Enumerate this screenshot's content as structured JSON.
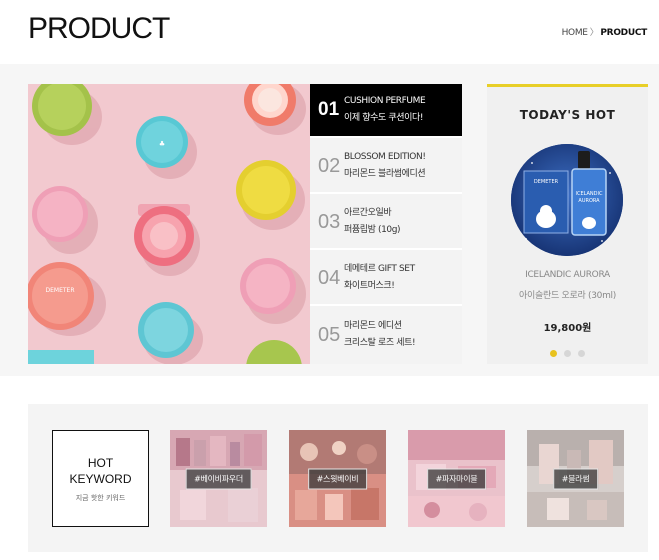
{
  "page": {
    "title": "PRODUCT"
  },
  "breadcrumb": {
    "home": "HOME",
    "separator": "〉",
    "current": "PRODUCT"
  },
  "product_list": [
    {
      "num": "01",
      "line1": "CUSHION PERFUME",
      "line2": "이제 향수도 쿠션이다!",
      "active": true
    },
    {
      "num": "02",
      "line1": "BLOSSOM EDITION!",
      "line2": "마리몬드 블라썸에디션",
      "active": false
    },
    {
      "num": "03",
      "line1": "아르간오일바",
      "line2": "퍼퓸립밤 (10g)",
      "active": false
    },
    {
      "num": "04",
      "line1": "데메테르 GIFT SET",
      "line2": "화이트머스크!",
      "active": false
    },
    {
      "num": "05",
      "line1": "마리몬드 에디션",
      "line2": "크리스탈 로즈 세트!",
      "active": false
    }
  ],
  "todays_hot": {
    "title": "TODAY'S HOT",
    "product_name": "ICELANDIC AURORA",
    "product_name_ko": "아이슬란드 오로라 (30ml)",
    "price": "19,800원",
    "slides": 3,
    "active_slide": 1
  },
  "keyword": {
    "box_line1": "HOT",
    "box_line2": "KEYWORD",
    "box_sub": "지금 핫한 키워드",
    "tags": [
      "#베이비파우더",
      "#스윗베이비",
      "#파자마이블",
      "#블라썸"
    ]
  },
  "colors": {
    "accent": "#e8cf28",
    "active_bg": "#000000",
    "hero_bg": "#f2c9cf",
    "band_bg": "#f6f6f6"
  }
}
